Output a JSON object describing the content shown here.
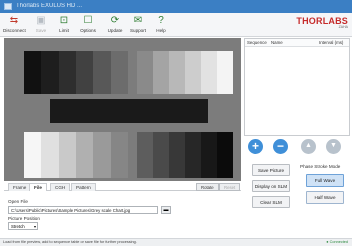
{
  "window": {
    "title": "Thorlabs EXULUS HD ..."
  },
  "toolbar": {
    "buttons": [
      {
        "label": "Disconnect",
        "icon": "disconnect-icon",
        "enabled": true
      },
      {
        "label": "Save",
        "icon": "save-icon",
        "enabled": false
      },
      {
        "label": "Limit",
        "icon": "limit-icon",
        "enabled": true
      },
      {
        "label": "Options",
        "icon": "options-icon",
        "enabled": true
      },
      {
        "label": "Update",
        "icon": "update-icon",
        "enabled": true
      },
      {
        "label": "Support",
        "icon": "support-icon",
        "enabled": true
      },
      {
        "label": "Help",
        "icon": "help-icon",
        "enabled": true
      }
    ],
    "brand": "THORLABS",
    "brand_sub": "ZAHA"
  },
  "preview": {
    "top_left_shades": [
      "#111111",
      "#1e1e1e",
      "#2e2e2e",
      "#414141",
      "#585858",
      "#6c6c6c"
    ],
    "top_right_shades": [
      "#8a8a8a",
      "#a4a4a4",
      "#b8b8b8",
      "#cdcdcd",
      "#e2e2e2",
      "#f4f4f4"
    ],
    "bottom_left_shades": [
      "#f6f6f6",
      "#e0e0e0",
      "#c9c9c9",
      "#b0b0b0",
      "#9a9a9a",
      "#868686"
    ],
    "bottom_right_shades": [
      "#5d5d5d",
      "#4a4a4a",
      "#383838",
      "#272727",
      "#181818",
      "#0b0b0b"
    ],
    "middle_bar_color": "#1a1a1a"
  },
  "sequence": {
    "columns": [
      "Sequence",
      "Name",
      "Interval (ms)"
    ]
  },
  "circle_buttons": [
    {
      "symbol": "+",
      "color": "#3f8fd8"
    },
    {
      "symbol": "−",
      "color": "#3f8fd8"
    },
    {
      "symbol": "▲",
      "color": "#b8c2cc"
    },
    {
      "symbol": "▼",
      "color": "#b8c2cc"
    }
  ],
  "tabs": [
    "Frame",
    "File",
    "CGH",
    "Pattern"
  ],
  "tabs_active": "File",
  "rotate_label": "Rotate",
  "reset_label": "Reset",
  "form": {
    "open_file_label": "Open File",
    "path_value": "C:\\Users\\Public\\Pictures\\Sample Pictures\\Grey scale Chart.jpg",
    "picture_position_label": "Picture Position",
    "picture_position_value": "Stretch"
  },
  "actions": {
    "save_picture": "Save Picture",
    "display_on_slm": "Display on SLM",
    "clear_slm": "Clear SLM",
    "phase_stroke_mode_label": "Phase Stroke Mode",
    "full_wave": "Full Wave",
    "half_wave": "Half Wave"
  },
  "status": {
    "message": "Load from file preview, add to sequence table or save file for further processing.",
    "connection": "● Connected"
  }
}
